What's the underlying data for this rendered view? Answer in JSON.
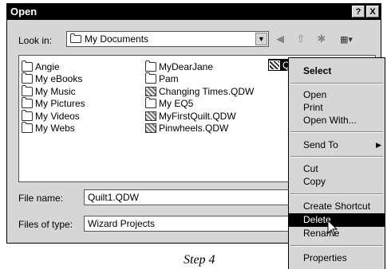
{
  "window": {
    "title": "Open",
    "help_btn": "?",
    "close_btn": "X"
  },
  "look_in": {
    "label": "Look in:",
    "value": "My Documents"
  },
  "files": {
    "col1": [
      "Angie",
      "My eBooks",
      "My Music",
      "My Pictures",
      "My Videos",
      "My Webs"
    ],
    "col2": [
      "MyDearJane",
      "Pam",
      "Changing Times.QDW",
      "My EQ5",
      "MyFirstQuilt.QDW",
      "Pinwheels.QDW"
    ],
    "selected": "Qu"
  },
  "file_name": {
    "label": "File name:",
    "value": "Quilt1.QDW"
  },
  "files_of_type": {
    "label": "Files of type:",
    "value": "Wizard Projects"
  },
  "context_menu": {
    "select": "Select",
    "open": "Open",
    "print": "Print",
    "open_with": "Open With...",
    "send_to": "Send To",
    "cut": "Cut",
    "copy": "Copy",
    "create_shortcut": "Create Shortcut",
    "delete": "Delete",
    "rename": "Rename",
    "properties": "Properties"
  },
  "caption": "Step 4"
}
